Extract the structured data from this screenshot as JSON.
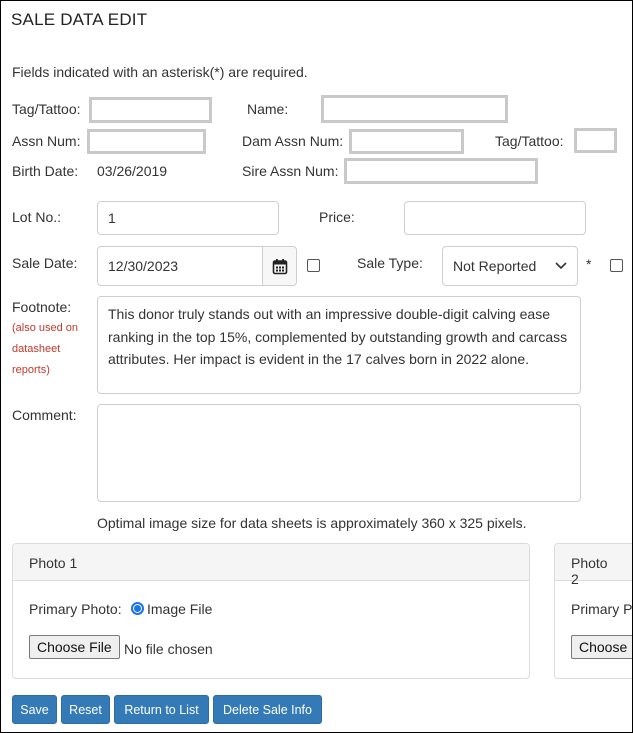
{
  "page": {
    "title": "SALE DATA EDIT",
    "required_note": "Fields indicated with an asterisk(*) are required."
  },
  "animal": {
    "tag_label": "Tag/Tattoo:",
    "name_label": "Name:",
    "assn_label": "Assn Num:",
    "dam_assn_label": "Dam Assn Num:",
    "dam_tag_label": "Tag/Tattoo:",
    "birth_label": "Birth Date:",
    "birth_value": "03/26/2019",
    "sire_assn_label": "Sire Assn Num:"
  },
  "sale": {
    "lot_label": "Lot No.:",
    "lot_value": "1",
    "price_label": "Price:",
    "price_value": "",
    "date_label": "Sale Date:",
    "date_value": "12/30/2023",
    "type_label": "Sale Type:",
    "type_value": "Not Reported",
    "required_mark": "*"
  },
  "footnote": {
    "label": "Footnote:",
    "hint_lines": [
      "(also used on",
      "datasheet",
      "reports)"
    ],
    "value": "This donor truly stands out with an impressive double-digit calving ease ranking in the top 15%, complemented by outstanding growth and carcass attributes. Her impact is evident in the 17 calves born in 2022 alone."
  },
  "comment": {
    "label": "Comment:",
    "value": ""
  },
  "image_note": "Optimal image size for data sheets is approximately 360 x 325 pixels.",
  "photos": [
    {
      "title": "Photo 1",
      "primary_label": "Primary Photo:",
      "radio_label": "Image File",
      "choose_label": "Choose File",
      "file_status": "No file chosen"
    },
    {
      "title": "Photo 2",
      "primary_label": "Primary P",
      "choose_label": "Choose"
    }
  ],
  "actions": {
    "save": "Save",
    "reset": "Reset",
    "return": "Return to List",
    "delete": "Delete Sale Info"
  },
  "colors": {
    "primary_button": "#337ab7",
    "hint_red": "#c0392b",
    "radio_blue": "#1a73e8"
  },
  "icons": {
    "date_picker": "calendar-icon",
    "select": "chevron-down-icon"
  }
}
